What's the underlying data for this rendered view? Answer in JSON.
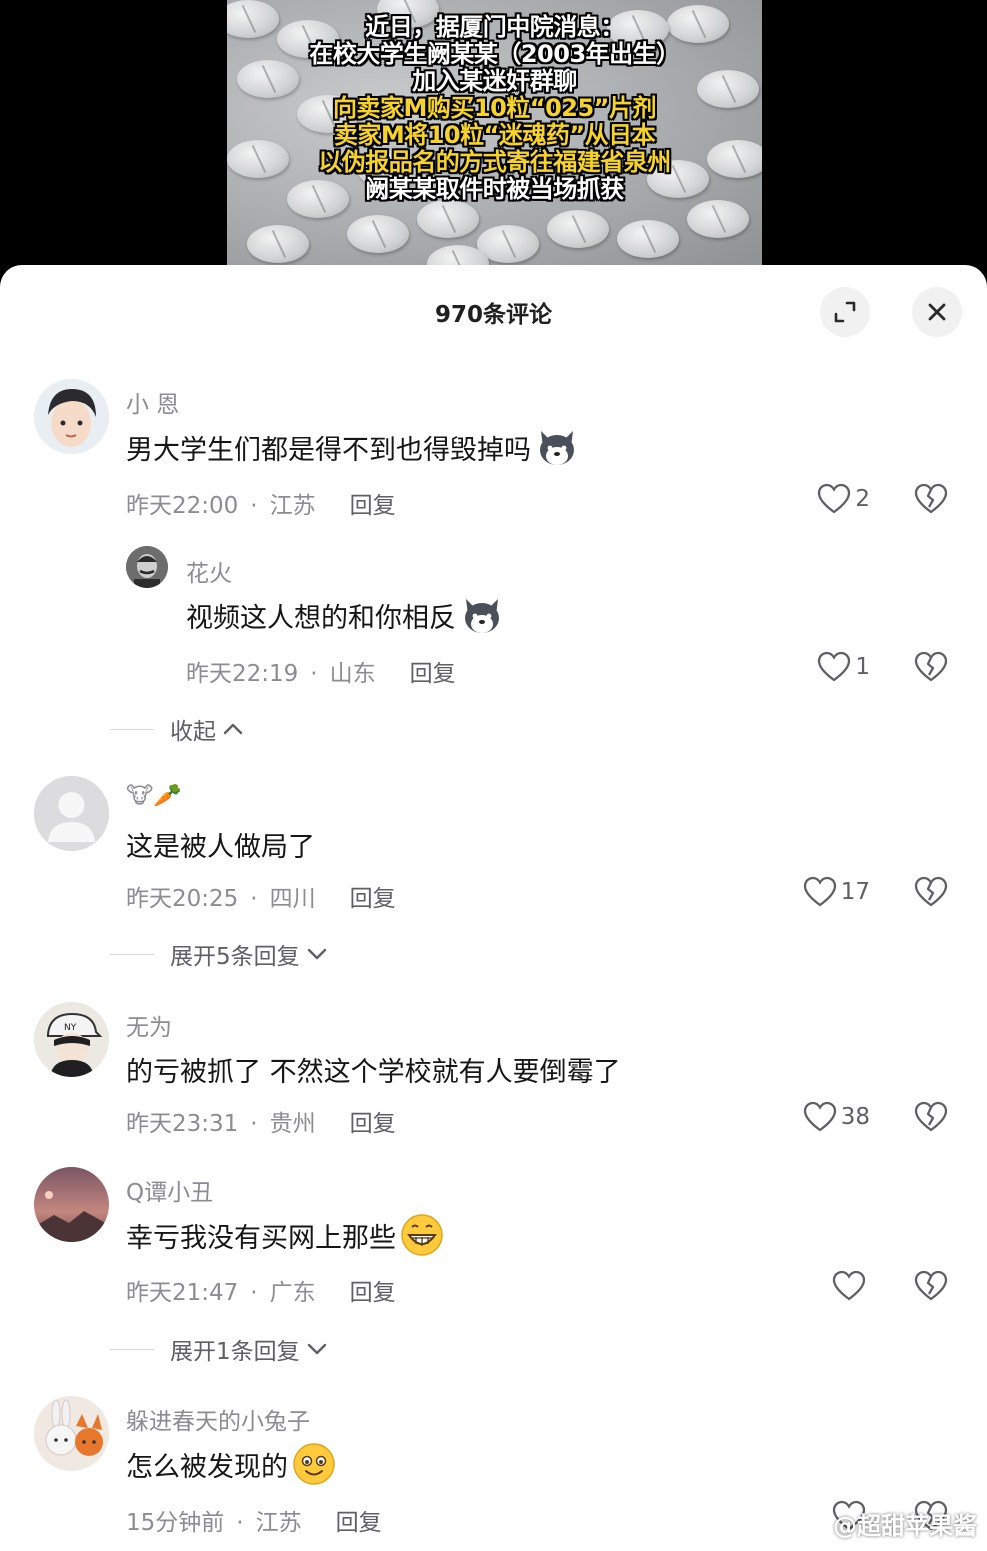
{
  "video": {
    "caption_lines": [
      {
        "text": "近日，据厦门中院消息：",
        "highlight": false
      },
      {
        "text": "在校大学生阙某某（2003年出生）",
        "highlight": false
      },
      {
        "text": "加入某迷奸群聊",
        "highlight": false
      },
      {
        "text": "向卖家M购买10粒“025”片剂",
        "highlight": true
      },
      {
        "text": "卖家M将10粒“迷魂药”从日本",
        "highlight": true
      },
      {
        "text": "以伪报品名的方式寄往福建省泉州",
        "highlight": true
      },
      {
        "text": "阙某某取件时被当场抓获",
        "highlight": false
      }
    ]
  },
  "panel": {
    "title": "970条评论",
    "expand_icon": "expand-icon",
    "close_icon": "close-icon"
  },
  "comments": [
    {
      "user": "小 恩",
      "text": "男大学生们都是得不到也得毁掉吗",
      "emoji": "husky-emoji",
      "time": "昨天22:00",
      "region": "江苏",
      "reply_label": "回复",
      "likes": "2"
    },
    {
      "user": "花火",
      "text": "视频这人想的和你相反",
      "emoji": "husky-emoji",
      "time": "昨天22:19",
      "region": "山东",
      "reply_label": "回复",
      "likes": "1"
    },
    {
      "user": "🐮🥕",
      "text": "这是被人做局了",
      "emoji": "",
      "time": "昨天20:25",
      "region": "四川",
      "reply_label": "回复",
      "likes": "17"
    },
    {
      "user": "无为",
      "text": "的亏被抓了 不然这个学校就有人要倒霉了",
      "emoji": "",
      "time": "昨天23:31",
      "region": "贵州",
      "reply_label": "回复",
      "likes": "38"
    },
    {
      "user": "Q谭小丑",
      "text": "幸亏我没有买网上那些",
      "emoji": "grin-emoji",
      "time": "昨天21:47",
      "region": "广东",
      "reply_label": "回复",
      "likes": ""
    },
    {
      "user": "躲进春天的小兔子",
      "text": "怎么被发现的",
      "emoji": "smile-emoji",
      "time": "15分钟前",
      "region": "江苏",
      "reply_label": "回复",
      "likes": ""
    }
  ],
  "folds": {
    "collapse": "收起",
    "expand_5": "展开5条回复",
    "expand_1": "展开1条回复"
  },
  "watermark": "@超甜苹果酱"
}
